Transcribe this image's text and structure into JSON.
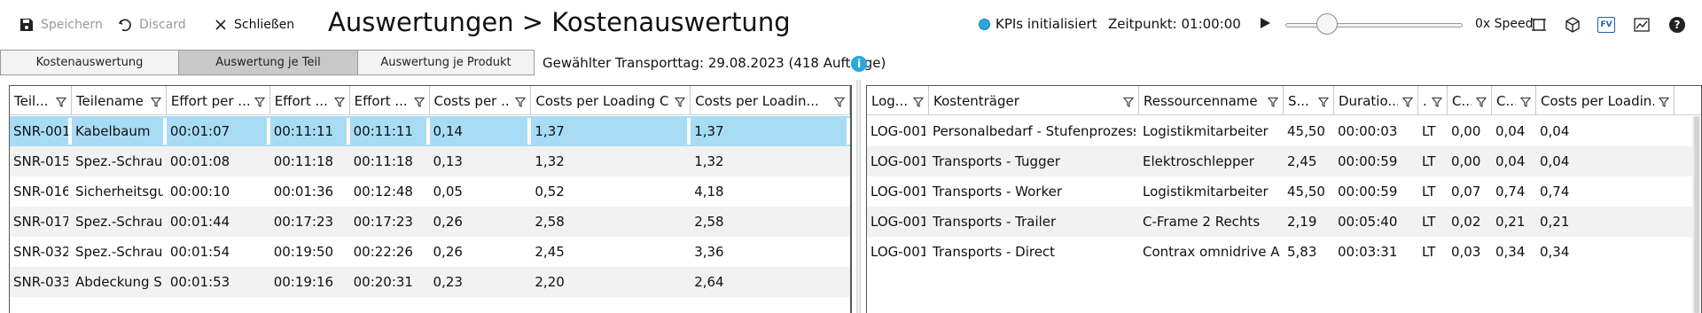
{
  "toolbar": {
    "save_label": "Speichern",
    "discard_label": "Discard",
    "close_label": "Schließen",
    "title": "Auswertungen > Kostenauswertung",
    "kpi_status": "KPIs initialisiert",
    "time_label": "Zeitpunkt: 01:00:00",
    "speed_label": "0x Speed",
    "speed_value": 0.2,
    "icons": [
      "fit-view-icon",
      "3d-cube-icon",
      "fv-icon",
      "chart-icon",
      "help-icon"
    ],
    "fv_text": "FV",
    "help_text": "?"
  },
  "tabs": [
    {
      "label": "Kostenauswertung"
    },
    {
      "label": "Auswertung je Teil"
    },
    {
      "label": "Auswertung je Produkt"
    }
  ],
  "transport_day": "Gewählter Transporttag: 29.08.2023 (418 Aufträge)",
  "colors": {
    "accent": "#29a8e0",
    "selection": "#a8dcf5",
    "active_tab": "#c9c9c9"
  },
  "left_table": {
    "columns": [
      "Teil...",
      "Teilename",
      "Effort per ...",
      "Effort ...",
      "Effort ...",
      "Costs per ...",
      "Costs per Loading C...",
      "Costs per Loadin..."
    ],
    "rows": [
      [
        "SNR-001",
        "Kabelbaum",
        "00:01:07",
        "00:11:11",
        "00:11:11",
        "0,14",
        "1,37",
        "1,37"
      ],
      [
        "SNR-015",
        "Spez.-Schraube",
        "00:01:08",
        "00:11:18",
        "00:11:18",
        "0,13",
        "1,32",
        "1,32"
      ],
      [
        "SNR-016",
        "Sicherheitsgurt",
        "00:00:10",
        "00:01:36",
        "00:12:48",
        "0,05",
        "0,52",
        "4,18"
      ],
      [
        "SNR-017",
        "Spez.-Schraube",
        "00:01:44",
        "00:17:23",
        "00:17:23",
        "0,26",
        "2,58",
        "2,58"
      ],
      [
        "SNR-032",
        "Spez.-Schraube",
        "00:01:54",
        "00:19:50",
        "00:22:26",
        "0,26",
        "2,45",
        "3,36"
      ],
      [
        "SNR-033",
        "Abdeckung Sich",
        "00:01:53",
        "00:19:16",
        "00:20:31",
        "0,23",
        "2,20",
        "2,64"
      ]
    ]
  },
  "right_table": {
    "columns": [
      "Log...",
      "Kostenträger",
      "Ressourcenname",
      "S...",
      "Duratio...",
      "...",
      "C...",
      "C...",
      "Costs per Loadin..."
    ],
    "rows": [
      [
        "LOG-001",
        "Personalbedarf - Stufenprozesse",
        "Logistikmitarbeiter",
        "45,50",
        "00:00:03",
        "LT",
        "0,00",
        "0,04",
        "0,04"
      ],
      [
        "LOG-001",
        "Transports - Tugger",
        "Elektroschlepper",
        "2,45",
        "00:00:59",
        "LT",
        "0,00",
        "0,04",
        "0,04"
      ],
      [
        "LOG-001",
        "Transports - Worker",
        "Logistikmitarbeiter",
        "45,50",
        "00:00:59",
        "LT",
        "0,07",
        "0,74",
        "0,74"
      ],
      [
        "LOG-001",
        "Transports - Trailer",
        "C-Frame 2 Rechts",
        "2,19",
        "00:05:40",
        "LT",
        "0,02",
        "0,21",
        "0,21"
      ],
      [
        "LOG-001",
        "Transports - Direct",
        "Contrax omnidrive AGV",
        "5,83",
        "00:03:31",
        "LT",
        "0,03",
        "0,34",
        "0,34"
      ]
    ]
  }
}
